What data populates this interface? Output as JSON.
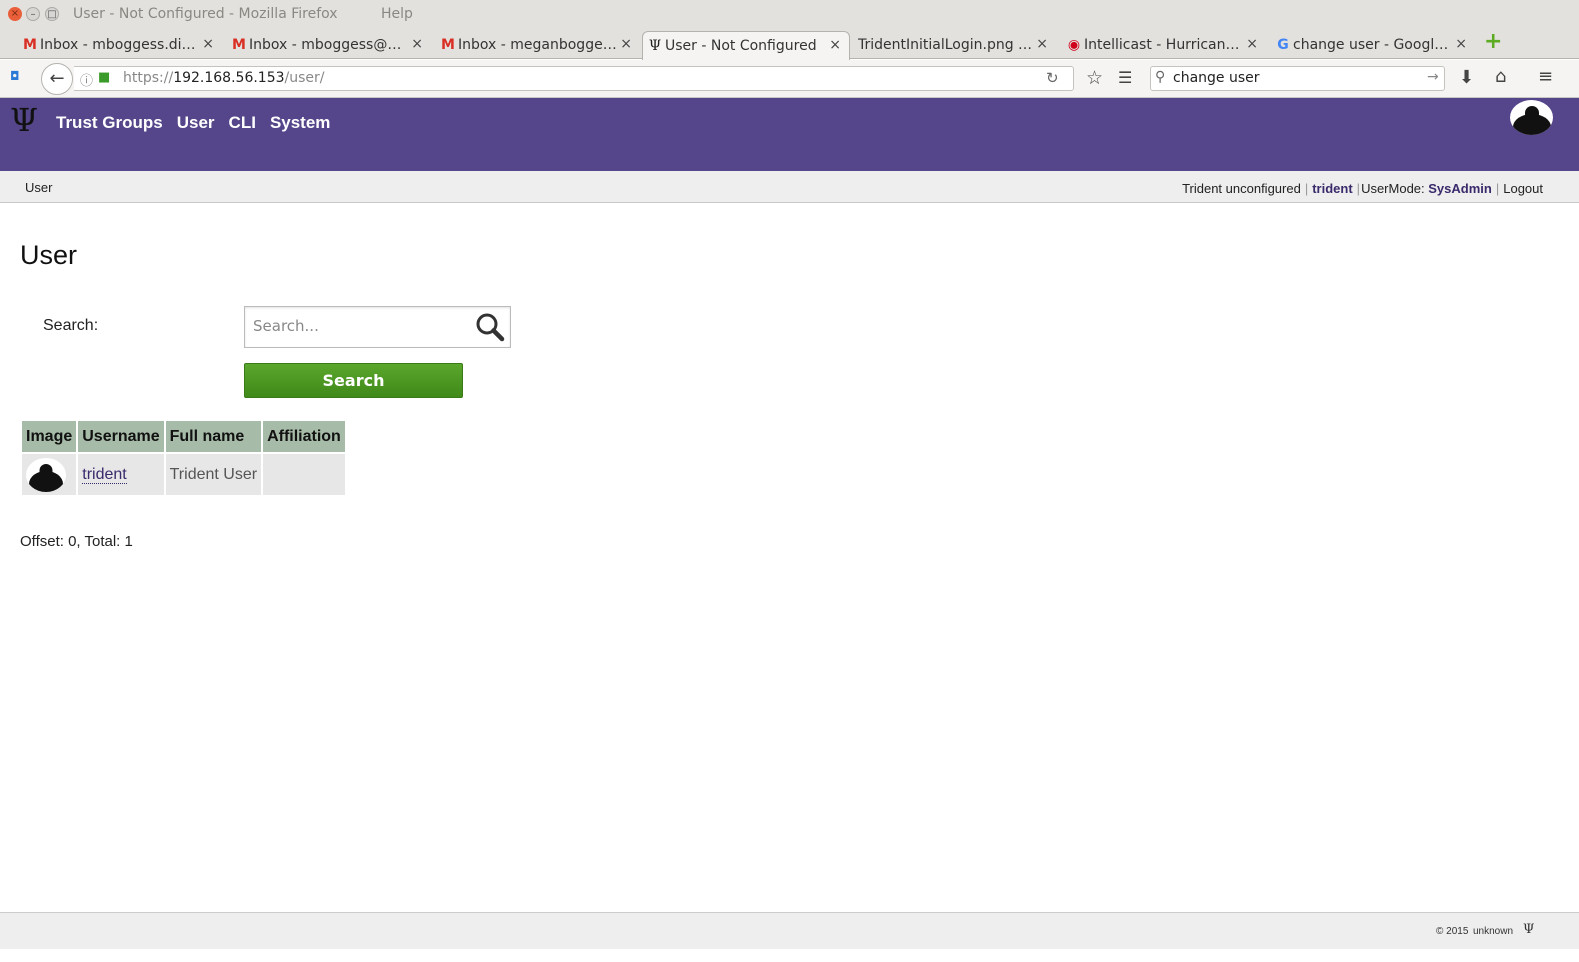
{
  "window": {
    "title": "User - Not Configured - Mozilla Firefox",
    "menu_help": "Help",
    "close_glyph": "×",
    "min_glyph": "–",
    "max_glyph": "□"
  },
  "tabs": [
    {
      "label": "Inbox - mboggess.di…",
      "icon": "gmail-icon"
    },
    {
      "label": "Inbox - mboggess@…",
      "icon": "gmail-icon"
    },
    {
      "label": "Inbox - meganbogge…",
      "icon": "gmail-icon"
    },
    {
      "label": "User - Not Configured",
      "icon": "trident-icon",
      "active": true
    },
    {
      "label": "TridentInitialLogin.png …",
      "icon": "none"
    },
    {
      "label": "Intellicast - Hurrican…",
      "icon": "intellicast-icon"
    },
    {
      "label": "change user - Googl…",
      "icon": "google-icon"
    }
  ],
  "tab_close": "×",
  "browser": {
    "url_scheme": "https://",
    "url_host": "192.168.56.153",
    "url_path": "/user/",
    "search_query": "change user"
  },
  "app": {
    "logo": "Ψ",
    "nav": [
      "Trust Groups",
      "User",
      "CLI",
      "System"
    ],
    "accent": "#55458a"
  },
  "crumbbar": {
    "breadcrumb": "User",
    "status": "Trident unconfigured",
    "username": "trident",
    "usermode_label": "UserMode:",
    "usermode": "SysAdmin",
    "logout": "Logout"
  },
  "page": {
    "title": "User",
    "search_label": "Search:",
    "search_placeholder": "Search...",
    "search_button": "Search"
  },
  "table": {
    "headers": [
      "Image",
      "Username",
      "Full name",
      "Affiliation"
    ],
    "rows": [
      {
        "username": "trident",
        "fullname": "Trident User",
        "affiliation": ""
      }
    ]
  },
  "pagination": "Offset: 0, Total: 1",
  "footer": {
    "copyright": "© 2015",
    "version": "unknown",
    "logo": "Ψ"
  }
}
